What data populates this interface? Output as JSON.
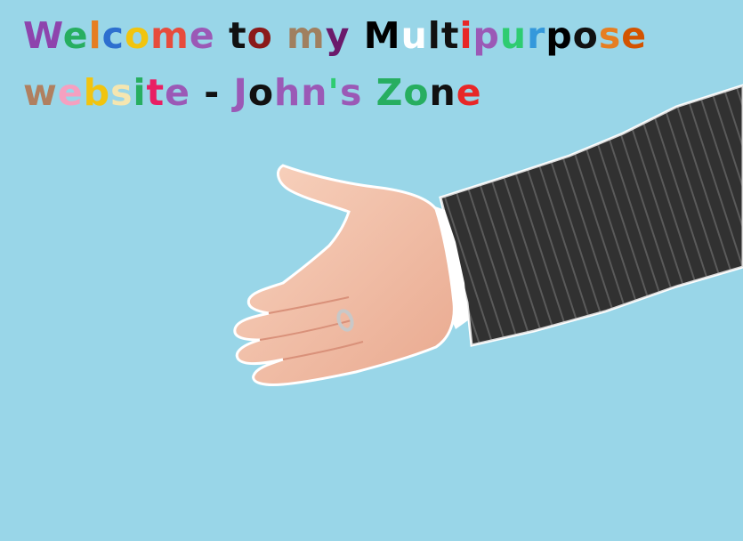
{
  "headline": {
    "line1": "Welcome to my  Multipurpose",
    "line2": "website - John's Zone",
    "line1_colors": [
      "#8e44ad",
      "#27ae60",
      "#e67e22",
      "#2d6fcf",
      "#f1c40f",
      "#e74c3c",
      "#9b59b6",
      "#111111",
      "#8b1a1a",
      "#a08060",
      "#6b1a6b",
      "#000000",
      "#ffffff",
      "#111111",
      "#111111",
      "#e82727",
      "#9b59b6",
      "#2ecc71",
      "#3498db",
      "#000000",
      "#111111",
      "#e67e22",
      "#d35400",
      "#27ae60",
      "#9b59b6",
      "#ff8c00",
      "#27ae60"
    ],
    "line2_colors": [
      "#b08060",
      "#f5a0c0",
      "#f1c40f",
      "#f5e6b0",
      "#27ae60",
      "#e91e63",
      "#9b59b6",
      "#111111",
      "#9b59b6",
      "#111111",
      "#9b59b6",
      "#9b59b6",
      "#2ecc71",
      "#9b59b6",
      "#27ae60",
      "#27ae60",
      "#111111",
      "#e82727",
      "#e82727",
      "#e82727",
      "#e82727"
    ]
  },
  "illustration": {
    "subject": "handshake-hand"
  }
}
